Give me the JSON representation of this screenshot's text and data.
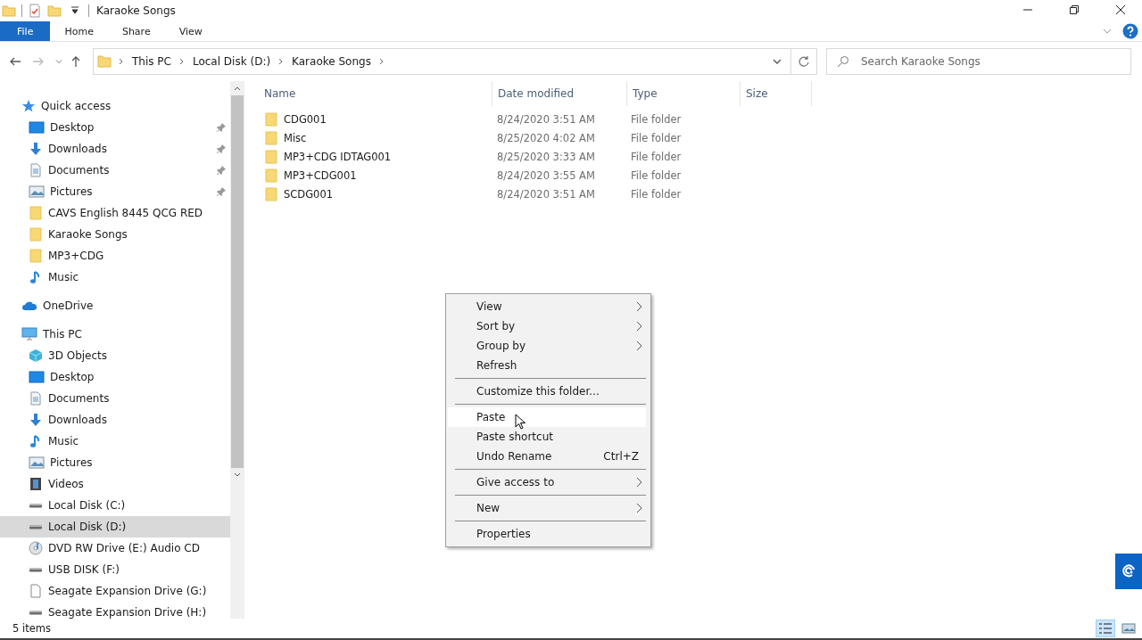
{
  "window": {
    "title": "Karaoke Songs"
  },
  "ribbon_tabs": [
    {
      "label": "File",
      "selected": true
    },
    {
      "label": "Home",
      "selected": false
    },
    {
      "label": "Share",
      "selected": false
    },
    {
      "label": "View",
      "selected": false
    }
  ],
  "address": {
    "breadcrumbs": [
      "This PC",
      "Local Disk (D:)",
      "Karaoke Songs"
    ]
  },
  "search": {
    "placeholder": "Search Karaoke Songs"
  },
  "nav_tree": [
    {
      "label": "Quick access",
      "kind": "star",
      "selected": false,
      "children": [
        {
          "label": "Desktop",
          "kind": "desktop",
          "pinned": true,
          "selected": false
        },
        {
          "label": "Downloads",
          "kind": "download",
          "pinned": true,
          "selected": false
        },
        {
          "label": "Documents",
          "kind": "document",
          "pinned": true,
          "selected": false
        },
        {
          "label": "Pictures",
          "kind": "picture",
          "pinned": true,
          "selected": false
        },
        {
          "label": "CAVS English 8445 QCG RED",
          "kind": "folder",
          "pinned": false,
          "selected": false
        },
        {
          "label": "Karaoke Songs",
          "kind": "folder",
          "pinned": false,
          "selected": false
        },
        {
          "label": "MP3+CDG",
          "kind": "folder",
          "pinned": false,
          "selected": false
        },
        {
          "label": "Music",
          "kind": "music",
          "pinned": false,
          "selected": false
        }
      ]
    },
    {
      "label": "OneDrive",
      "kind": "cloud",
      "selected": false
    },
    {
      "label": "This PC",
      "kind": "computer",
      "selected": false,
      "children": [
        {
          "label": "3D Objects",
          "kind": "cube",
          "pinned": false,
          "selected": false
        },
        {
          "label": "Desktop",
          "kind": "desktop",
          "pinned": false,
          "selected": false
        },
        {
          "label": "Documents",
          "kind": "document",
          "pinned": false,
          "selected": false
        },
        {
          "label": "Downloads",
          "kind": "download",
          "pinned": false,
          "selected": false
        },
        {
          "label": "Music",
          "kind": "music",
          "pinned": false,
          "selected": false
        },
        {
          "label": "Pictures",
          "kind": "picture",
          "pinned": false,
          "selected": false
        },
        {
          "label": "Videos",
          "kind": "film",
          "pinned": false,
          "selected": false
        },
        {
          "label": "Local Disk (C:)",
          "kind": "drive",
          "pinned": false,
          "selected": false
        },
        {
          "label": "Local Disk (D:)",
          "kind": "drive",
          "pinned": false,
          "selected": true
        },
        {
          "label": "DVD RW Drive (E:) Audio CD",
          "kind": "disc",
          "pinned": false,
          "selected": false
        },
        {
          "label": "USB DISK (F:)",
          "kind": "drive",
          "pinned": false,
          "selected": false
        },
        {
          "label": "Seagate Expansion Drive (G:)",
          "kind": "blank",
          "pinned": false,
          "selected": false
        },
        {
          "label": "Seagate Expansion Drive (H:)",
          "kind": "drive",
          "pinned": false,
          "selected": false
        }
      ]
    }
  ],
  "table": {
    "columns": [
      "Name",
      "Date modified",
      "Type",
      "Size"
    ],
    "rows": [
      {
        "name": "CDG001",
        "date": "8/24/2020 3:51 AM",
        "type": "File folder"
      },
      {
        "name": "Misc",
        "date": "8/25/2020 4:02 AM",
        "type": "File folder"
      },
      {
        "name": "MP3+CDG IDTAG001",
        "date": "8/25/2020 3:33 AM",
        "type": "File folder"
      },
      {
        "name": "MP3+CDG001",
        "date": "8/24/2020 3:55 AM",
        "type": "File folder"
      },
      {
        "name": "SCDG001",
        "date": "8/24/2020 3:51 AM",
        "type": "File folder"
      }
    ]
  },
  "context_menu": {
    "groups": [
      [
        {
          "label": "View",
          "submenu": true,
          "selected": false
        },
        {
          "label": "Sort by",
          "submenu": true,
          "selected": false
        },
        {
          "label": "Group by",
          "submenu": true,
          "selected": false
        },
        {
          "label": "Refresh",
          "submenu": false,
          "selected": false
        }
      ],
      [
        {
          "label": "Customize this folder...",
          "submenu": false,
          "selected": false
        }
      ],
      [
        {
          "label": "Paste",
          "submenu": false,
          "selected": true
        },
        {
          "label": "Paste shortcut",
          "submenu": false,
          "selected": false
        },
        {
          "label": "Undo Rename",
          "shortcut": "Ctrl+Z",
          "submenu": false,
          "selected": false
        }
      ],
      [
        {
          "label": "Give access to",
          "submenu": true,
          "selected": false
        }
      ],
      [
        {
          "label": "New",
          "submenu": true,
          "selected": false
        }
      ],
      [
        {
          "label": "Properties",
          "submenu": false,
          "selected": false
        }
      ]
    ]
  },
  "status_bar": {
    "text": "5 items"
  },
  "view_toggles": [
    {
      "kind": "details",
      "selected": true
    },
    {
      "kind": "large-icons",
      "selected": false
    }
  ]
}
